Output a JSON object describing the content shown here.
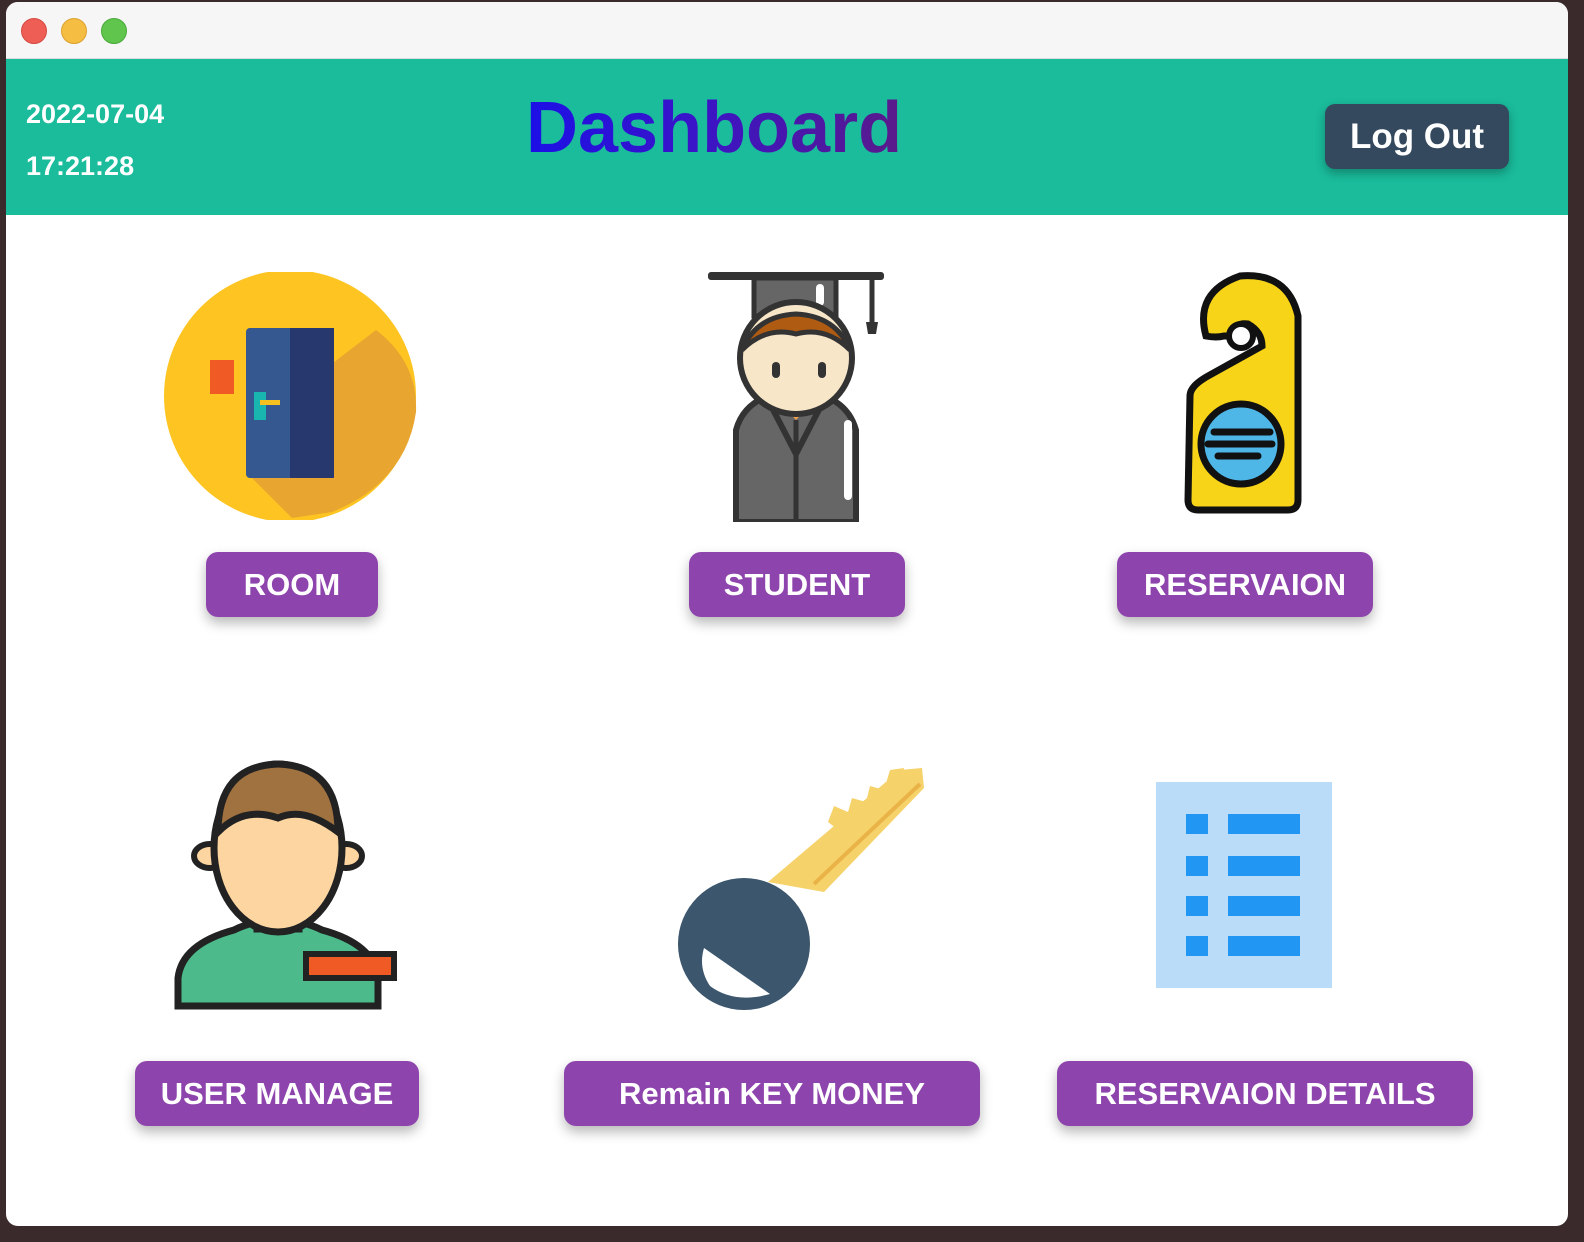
{
  "header": {
    "date": "2022-07-04",
    "time": "17:21:28",
    "title": "Dashboard",
    "logout_label": "Log Out"
  },
  "tiles": {
    "room": {
      "label": "ROOM",
      "icon": "door-icon"
    },
    "student": {
      "label": "STUDENT",
      "icon": "graduate-icon"
    },
    "reservation": {
      "label": "RESERVAION",
      "icon": "door-hanger-icon"
    },
    "user_manage": {
      "label": "USER MANAGE",
      "icon": "user-icon"
    },
    "key_money": {
      "label": "Remain KEY MONEY",
      "icon": "key-icon"
    },
    "reservation_details": {
      "label": "RESERVAION DETAILS",
      "icon": "list-icon"
    }
  },
  "colors": {
    "header_bg": "#1abc9c",
    "button_bg": "#8e44ad",
    "logout_bg": "#34495e"
  }
}
